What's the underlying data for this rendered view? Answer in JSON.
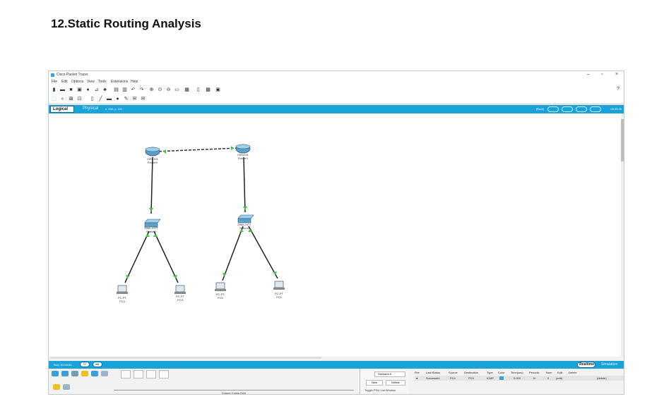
{
  "page": {
    "heading": "12.Static Routing Analysis"
  },
  "window": {
    "title": "Cisco Packet Tracer",
    "controls": {
      "minimize": "–",
      "maximize": "▫",
      "close": "×"
    },
    "menu": [
      "File",
      "Edit",
      "Options",
      "View",
      "Tools",
      "Extensions",
      "Help"
    ],
    "help_icon": "?"
  },
  "viewbar": {
    "logical_tab": "Logical",
    "physical_tab": "Physical",
    "coords": "x: 466, y: 191",
    "root": "[Root]",
    "clock": "00:25:26"
  },
  "topology": {
    "devices": [
      {
        "id": "router0",
        "type": "router",
        "model": "ISR4331",
        "name": "Router0"
      },
      {
        "id": "router1",
        "type": "router",
        "model": "ISR4331",
        "name": "Router1"
      },
      {
        "id": "switch0",
        "type": "switch",
        "model": "2960-24TT",
        "name": "Switch0"
      },
      {
        "id": "switch1",
        "type": "switch",
        "model": "2960-24TT",
        "name": "Switch1"
      },
      {
        "id": "pc4",
        "type": "pc",
        "model": "PC-PT",
        "name": "PC4"
      },
      {
        "id": "pc3",
        "type": "pc",
        "model": "PC-PT",
        "name": "PC3"
      },
      {
        "id": "pc0",
        "type": "pc",
        "model": "PC-PT",
        "name": "PC0"
      },
      {
        "id": "pc1",
        "type": "pc",
        "model": "PC-PT",
        "name": "PC1"
      }
    ],
    "links": [
      {
        "from": "router0",
        "to": "router1",
        "cable": "dashed"
      },
      {
        "from": "router0",
        "to": "switch0",
        "cable": "solid"
      },
      {
        "from": "router1",
        "to": "switch1",
        "cable": "solid"
      },
      {
        "from": "switch0",
        "to": "pc4",
        "cable": "solid"
      },
      {
        "from": "switch0",
        "to": "pc3",
        "cable": "solid"
      },
      {
        "from": "switch1",
        "to": "pc0",
        "cable": "solid"
      },
      {
        "from": "switch1",
        "to": "pc1",
        "cable": "solid"
      }
    ]
  },
  "timebar": {
    "time": "Time: 00:04:53",
    "realtime": "Realtime",
    "simulation": "Simulation"
  },
  "bottom": {
    "connection_name": "Copper Cross-Over",
    "pdu": {
      "scenario": "Scenario 0",
      "new": "New",
      "delete": "Delete",
      "toggle": "Toggle PDU List Window"
    },
    "events": {
      "headers": [
        "Fire",
        "Last Status",
        "Source",
        "Destination",
        "Type",
        "Color",
        "Time(sec)",
        "Periodic",
        "Num",
        "Edit",
        "Delete"
      ],
      "rows": [
        {
          "fire": "●",
          "status": "Successful",
          "source": "PC4",
          "destination": "PC3",
          "type": "ICMP",
          "color": "#3aa0d8",
          "time": "0.000",
          "periodic": "N",
          "num": "0",
          "edit": "(edit)",
          "delete": "(delete)"
        }
      ]
    }
  },
  "colors": {
    "accent": "#1aa3d9",
    "link_up": "#3ec63e",
    "router": "#5aa0c8"
  }
}
